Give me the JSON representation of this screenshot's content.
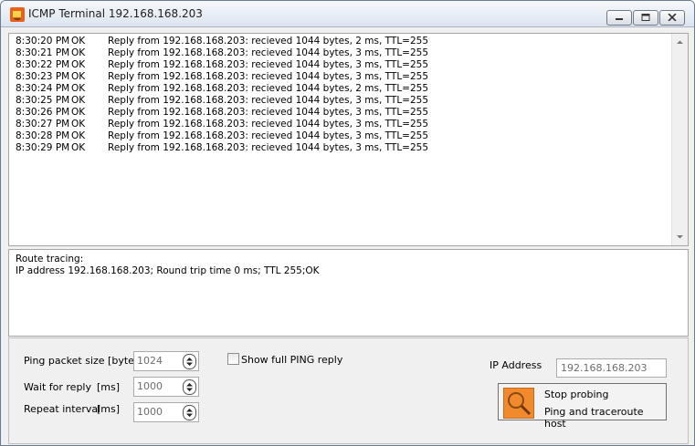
{
  "window": {
    "title": "ICMP Terminal 192.168.168.203"
  },
  "log": {
    "lines": [
      {
        "time": "8:30:20 PM",
        "status": "OK",
        "message": "Reply from 192.168.168.203: recieved 1044 bytes, 2 ms, TTL=255"
      },
      {
        "time": "8:30:21 PM",
        "status": "OK",
        "message": "Reply from 192.168.168.203: recieved 1044 bytes, 3 ms, TTL=255"
      },
      {
        "time": "8:30:22 PM",
        "status": "OK",
        "message": "Reply from 192.168.168.203: recieved 1044 bytes, 3 ms, TTL=255"
      },
      {
        "time": "8:30:23 PM",
        "status": "OK",
        "message": "Reply from 192.168.168.203: recieved 1044 bytes, 3 ms, TTL=255"
      },
      {
        "time": "8:30:24 PM",
        "status": "OK",
        "message": "Reply from 192.168.168.203: recieved 1044 bytes, 2 ms, TTL=255"
      },
      {
        "time": "8:30:25 PM",
        "status": "OK",
        "message": "Reply from 192.168.168.203: recieved 1044 bytes, 3 ms, TTL=255"
      },
      {
        "time": "8:30:26 PM",
        "status": "OK",
        "message": "Reply from 192.168.168.203: recieved 1044 bytes, 3 ms, TTL=255"
      },
      {
        "time": "8:30:27 PM",
        "status": "OK",
        "message": "Reply from 192.168.168.203: recieved 1044 bytes, 3 ms, TTL=255"
      },
      {
        "time": "8:30:28 PM",
        "status": "OK",
        "message": "Reply from 192.168.168.203: recieved 1044 bytes, 3 ms, TTL=255"
      },
      {
        "time": "8:30:29 PM",
        "status": "OK",
        "message": "Reply from 192.168.168.203: recieved 1044 bytes, 3 ms, TTL=255"
      }
    ]
  },
  "trace": {
    "heading": "Route tracing:",
    "line": "IP address 192.168.168.203; Round trip time 0 ms; TTL 255;OK"
  },
  "settings": {
    "packet_size_label": "Ping packet size [byte]",
    "packet_size_value": "1024",
    "wait_label": "Wait for reply",
    "wait_unit": "[ms]",
    "wait_value": "1000",
    "repeat_label": "Repeat interval",
    "repeat_unit": "[ms]",
    "repeat_value": "1000",
    "show_full_label": "Show full PING reply"
  },
  "ip": {
    "label": "IP Address",
    "value": "192.168.168.203"
  },
  "action": {
    "line1": "Stop probing",
    "line2": "Ping and traceroute host"
  },
  "colors": {
    "accent": "#e8611a",
    "button_icon": "#f08a2c"
  },
  "icons": {
    "app": "terminal-app-icon",
    "action": "magnifier-icon"
  }
}
